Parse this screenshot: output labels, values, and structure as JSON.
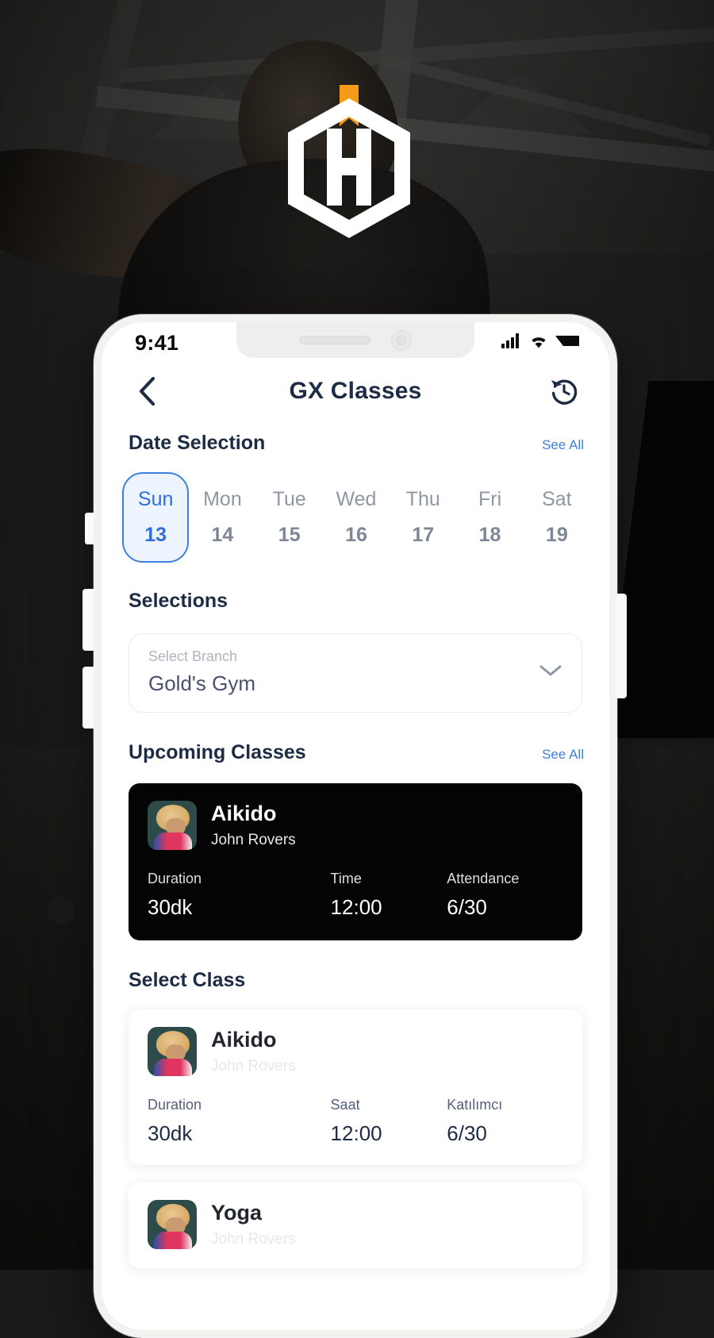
{
  "brand": {
    "logo_icon": "hexagon-h-logo",
    "logo_accent_color": "#F59B18",
    "logo_color": "#FFFFFF"
  },
  "theme": {
    "accent_blue": "#3F7FE0",
    "heading_navy": "#1D2B45",
    "dark_card_bg": "#040404",
    "selected_date_bg": "#EEF4FD"
  },
  "device": {
    "status_bar": {
      "time": "9:41",
      "icons": [
        "signal-icon",
        "wifi-icon",
        "battery-icon"
      ]
    },
    "hardware_buttons": [
      "mute-switch",
      "volume-up-button",
      "volume-down-button",
      "power-button"
    ]
  },
  "navbar": {
    "back_icon": "chevron-left-icon",
    "title": "GX Classes",
    "history_icon": "history-clock-icon"
  },
  "date_selection": {
    "title": "Date Selection",
    "see_all": "See All",
    "days": [
      {
        "dow": "Sun",
        "num": "13",
        "selected": true
      },
      {
        "dow": "Mon",
        "num": "14",
        "selected": false
      },
      {
        "dow": "Tue",
        "num": "15",
        "selected": false
      },
      {
        "dow": "Wed",
        "num": "16",
        "selected": false
      },
      {
        "dow": "Thu",
        "num": "17",
        "selected": false
      },
      {
        "dow": "Fri",
        "num": "18",
        "selected": false
      },
      {
        "dow": "Sat",
        "num": "19",
        "selected": false
      }
    ]
  },
  "selections": {
    "title": "Selections",
    "branch_field": {
      "label": "Select Branch",
      "value": "Gold's Gym",
      "chevron_icon": "chevron-down-icon"
    }
  },
  "upcoming_classes": {
    "title": "Upcoming Classes",
    "see_all": "See All",
    "card": {
      "thumbnail_icon": "class-photo-thumbnail",
      "name": "Aikido",
      "instructor": "John Rovers",
      "stats": [
        {
          "label": "Duration",
          "value": "30dk"
        },
        {
          "label": "Time",
          "value": "12:00"
        },
        {
          "label": "Attendance",
          "value": "6/30"
        }
      ]
    }
  },
  "select_class": {
    "title": "Select Class",
    "items": [
      {
        "thumbnail_icon": "class-photo-thumbnail",
        "name": "Aikido",
        "instructor": "John Rovers",
        "stats": [
          {
            "label": "Duration",
            "value": "30dk"
          },
          {
            "label": "Saat",
            "value": "12:00"
          },
          {
            "label": "Katılımcı",
            "value": "6/30"
          }
        ]
      },
      {
        "thumbnail_icon": "class-photo-thumbnail",
        "name": "Yoga",
        "instructor": "John Rovers",
        "stats": []
      }
    ]
  }
}
